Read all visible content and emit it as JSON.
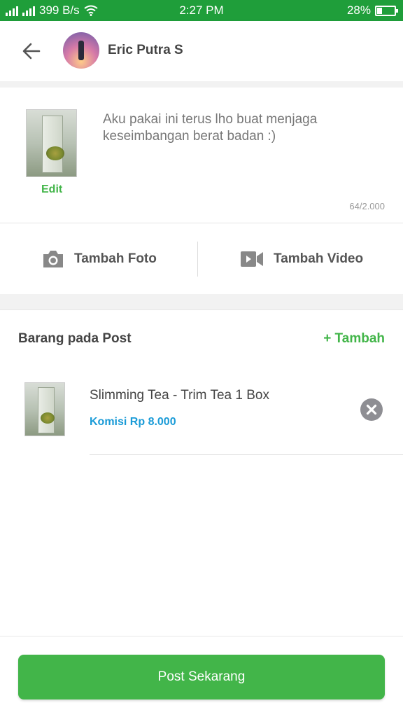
{
  "status_bar": {
    "network_speed": "399 B/s",
    "time": "2:27 PM",
    "battery_percent": "28%",
    "battery_level": 0.28
  },
  "header": {
    "user_name": "Eric Putra S",
    "back_icon": "arrow-left-icon"
  },
  "compose": {
    "caption": "Aku pakai ini terus lho buat menjaga keseimbangan berat badan :)",
    "edit_label": "Edit",
    "char_counter": "64/2.000"
  },
  "media": {
    "add_photo_label": "Tambah Foto",
    "add_video_label": "Tambah Video",
    "photo_icon": "camera-icon",
    "video_icon": "video-camera-icon"
  },
  "items": {
    "title": "Barang pada Post",
    "add_label": "+ Tambah",
    "list": [
      {
        "name": "Slimming Tea - Trim Tea 1 Box",
        "commission": "Komisi Rp 8.000"
      }
    ]
  },
  "footer": {
    "post_label": "Post Sekarang"
  },
  "colors": {
    "status_bar": "#1f9e3a",
    "accent_green": "#42b549",
    "commission_blue": "#1a9bd7"
  }
}
